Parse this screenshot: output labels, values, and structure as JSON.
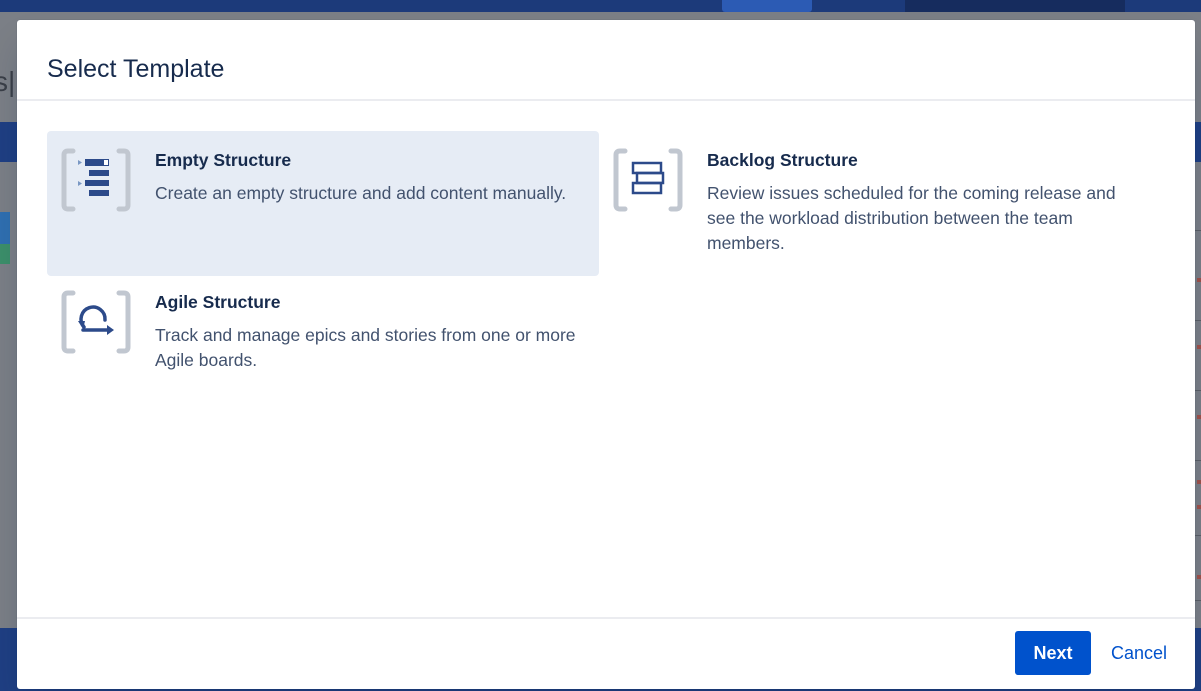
{
  "background": {
    "left_partial_text": "s|"
  },
  "dialog": {
    "title": "Select Template",
    "templates": [
      {
        "name": "Empty Structure",
        "description": "Create an empty structure and add content manually.",
        "icon": "empty-structure-icon",
        "selected": true
      },
      {
        "name": "Backlog Structure",
        "description": "Review issues scheduled for the coming release and see the workload distribution between the team members.",
        "icon": "backlog-structure-icon",
        "selected": false
      },
      {
        "name": "Agile Structure",
        "description": "Track and manage epics and stories from one or more Agile boards.",
        "icon": "agile-structure-icon",
        "selected": false
      }
    ],
    "footer": {
      "next_label": "Next",
      "cancel_label": "Cancel"
    }
  },
  "colors": {
    "primary": "#0052cc",
    "selected_bg": "#e6ecf5",
    "icon_bracket": "#c1c7d0",
    "icon_fill": "#2c4a8a"
  }
}
